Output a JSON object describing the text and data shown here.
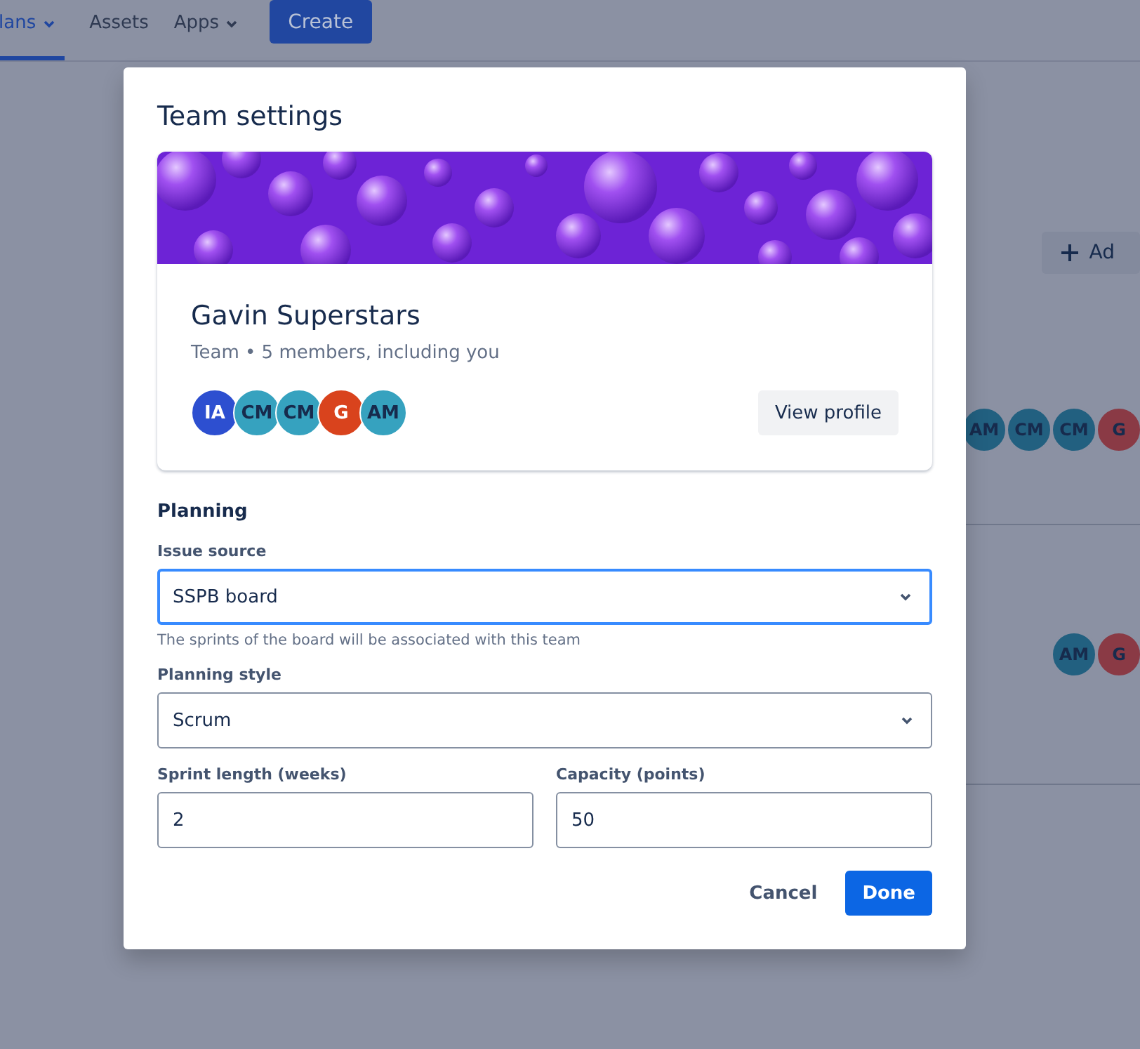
{
  "nav": {
    "items": [
      {
        "label": "lans",
        "selected": true,
        "dropdown": true
      },
      {
        "label": "Assets",
        "selected": false,
        "dropdown": false
      },
      {
        "label": "Apps",
        "selected": false,
        "dropdown": true
      }
    ],
    "create_button": "Create"
  },
  "background": {
    "add_button": "Ad",
    "rows": [
      {
        "avatars": [
          {
            "initials": "AM",
            "color": "#226080"
          },
          {
            "initials": "CM",
            "color": "#226080"
          },
          {
            "initials": "CM",
            "color": "#226080"
          },
          {
            "initials": "G",
            "color": "#8a3a45"
          }
        ]
      },
      {
        "avatars": [
          {
            "initials": "AM",
            "color": "#226080"
          },
          {
            "initials": "G",
            "color": "#8a3a45"
          }
        ]
      }
    ]
  },
  "dialog": {
    "title": "Team settings",
    "team": {
      "name": "Gavin Superstars",
      "subtitle": "Team • 5 members, including you",
      "avatars": [
        {
          "initials": "IA",
          "color": "#2d4fd0"
        },
        {
          "initials": "CM",
          "color": "#36a2bf"
        },
        {
          "initials": "CM",
          "color": "#36a2bf"
        },
        {
          "initials": "G",
          "color": "#d9431d"
        },
        {
          "initials": "AM",
          "color": "#36a2bf"
        }
      ],
      "view_profile_button": "View profile"
    },
    "section": "Planning",
    "issue_source": {
      "label": "Issue source",
      "value": "SSPB board",
      "focused": true,
      "help": "The sprints of the board will be associated with this team"
    },
    "planning_style": {
      "label": "Planning style",
      "value": "Scrum",
      "focused": false
    },
    "sprint_length": {
      "label": "Sprint length (weeks)",
      "value": "2"
    },
    "capacity": {
      "label": "Capacity (points)",
      "value": "50"
    },
    "buttons": [
      {
        "label": "Cancel",
        "kind": "subtle"
      },
      {
        "label": "Done",
        "kind": "primary"
      }
    ]
  }
}
